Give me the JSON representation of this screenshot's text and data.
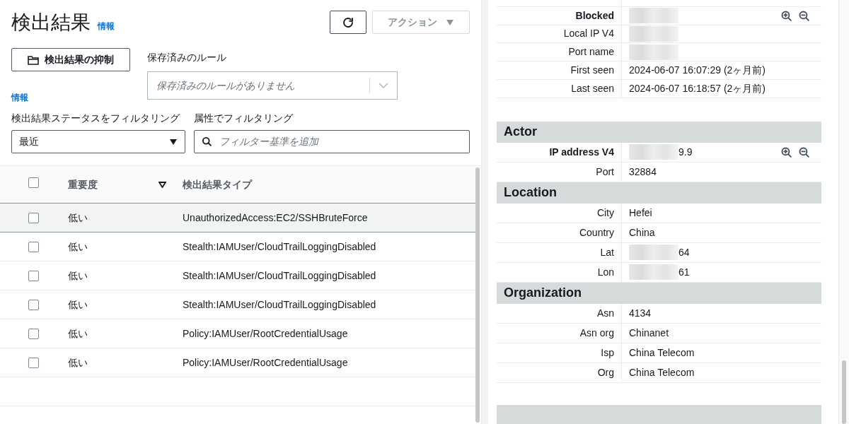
{
  "header": {
    "title": "検出結果",
    "info_link": "情報",
    "actions_button": "アクション"
  },
  "suppress_button": "検出結果の抑制",
  "info_link": "情報",
  "saved_rules": {
    "label": "保存済みのルール",
    "placeholder": "保存済みのルールがありません"
  },
  "status_filter": {
    "label": "検出結果ステータスをフィルタリング",
    "value": "最近"
  },
  "attribute_filter": {
    "label": "属性でフィルタリング",
    "placeholder": "フィルター基準を追加"
  },
  "table": {
    "columns": [
      {
        "label": "重要度",
        "sorted": true
      },
      {
        "label": "検出結果タイプ",
        "sorted": false
      }
    ],
    "header_checked": false,
    "rows": [
      {
        "severity": "低い",
        "type": "UnauthorizedAccess:EC2/SSHBruteForce",
        "selected": true,
        "checked": false
      },
      {
        "severity": "低い",
        "type": "Stealth:IAMUser/CloudTrailLoggingDisabled",
        "selected": false,
        "checked": false
      },
      {
        "severity": "低い",
        "type": "Stealth:IAMUser/CloudTrailLoggingDisabled",
        "selected": false,
        "checked": false
      },
      {
        "severity": "低い",
        "type": "Stealth:IAMUser/CloudTrailLoggingDisabled",
        "selected": false,
        "checked": false
      },
      {
        "severity": "低い",
        "type": "Policy:IAMUser/RootCredentialUsage",
        "selected": false,
        "checked": false
      },
      {
        "severity": "低い",
        "type": "Policy:IAMUser/RootCredentialUsage",
        "selected": false,
        "checked": false
      }
    ]
  },
  "details": {
    "top_rows": [
      {
        "label": "Blocked",
        "redacted": true,
        "zoom": true
      },
      {
        "label": "Local IP V4",
        "redacted": true,
        "zoom": false
      },
      {
        "label": "Port name",
        "redacted": true,
        "zoom": false
      },
      {
        "label": "First seen",
        "value": "2024-06-07 16:07:29 (2ヶ月前)",
        "redacted": false,
        "zoom": false
      },
      {
        "label": "Last seen",
        "value": "2024-06-07 16:18:57 (2ヶ月前)",
        "redacted": false,
        "zoom": false
      }
    ],
    "sections": [
      {
        "title": "Actor",
        "rows": [
          {
            "label": "IP address V4",
            "value": "9.9",
            "redacted": true,
            "zoom": true
          },
          {
            "label": "Port",
            "value": "32884",
            "redacted": false,
            "zoom": false
          }
        ]
      },
      {
        "title": "Location",
        "rows": [
          {
            "label": "City",
            "value": "Hefei",
            "redacted": false,
            "zoom": false
          },
          {
            "label": "Country",
            "value": "China",
            "redacted": false,
            "zoom": false
          },
          {
            "label": "Lat",
            "value": "64",
            "redacted": true,
            "zoom": false
          },
          {
            "label": "Lon",
            "value": "61",
            "redacted": true,
            "zoom": false
          }
        ]
      },
      {
        "title": "Organization",
        "rows": [
          {
            "label": "Asn",
            "value": "4134",
            "redacted": false,
            "zoom": false
          },
          {
            "label": "Asn org",
            "value": "Chinanet",
            "redacted": false,
            "zoom": false
          },
          {
            "label": "Isp",
            "value": "China Telecom",
            "redacted": false,
            "zoom": false
          },
          {
            "label": "Org",
            "value": "China Telecom",
            "redacted": false,
            "zoom": false
          }
        ]
      }
    ]
  }
}
